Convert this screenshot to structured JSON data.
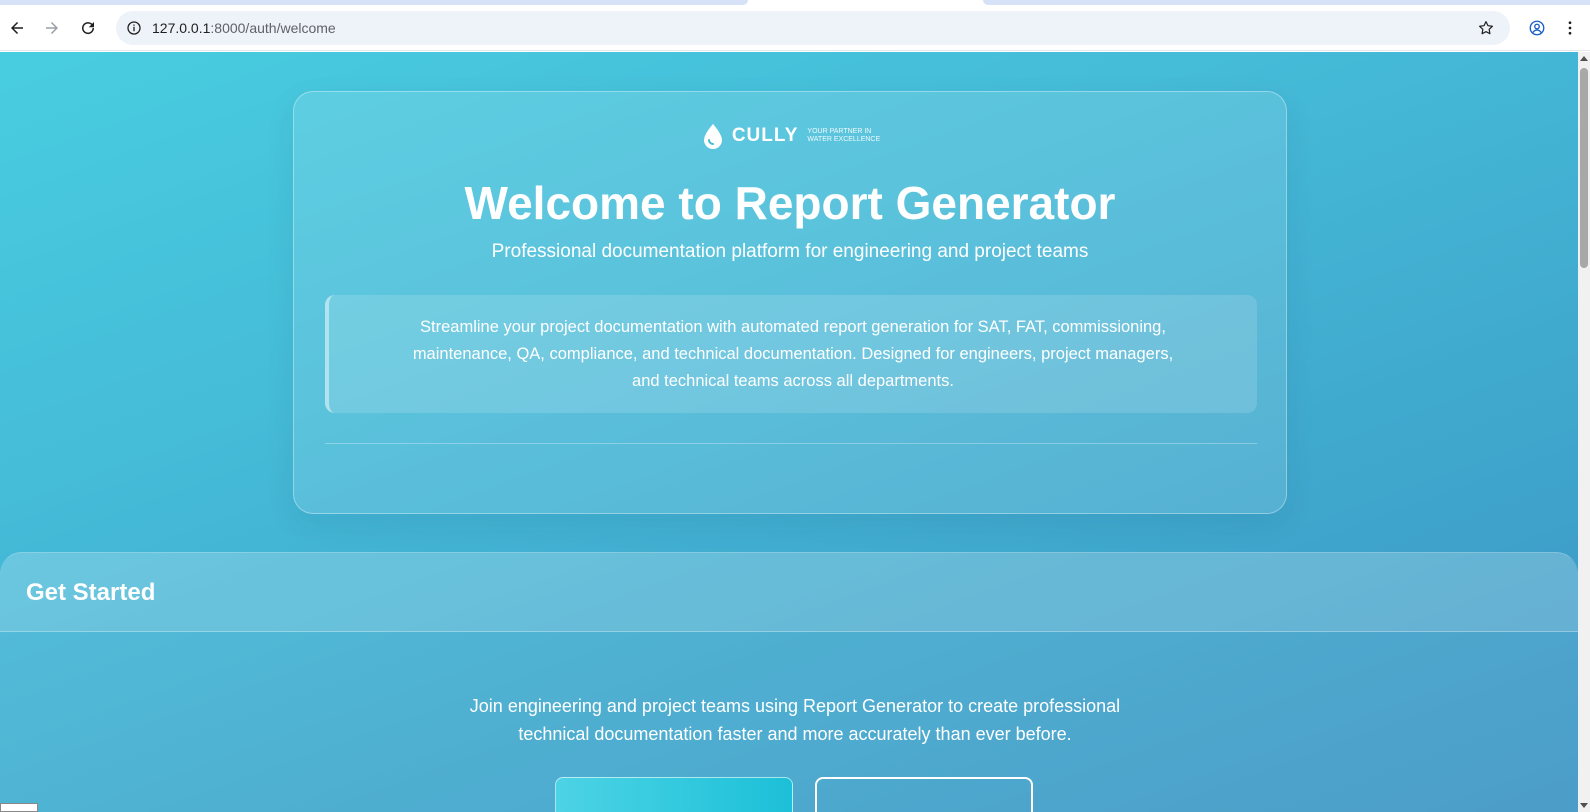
{
  "browser": {
    "url_host": "127.0.0.1",
    "url_path": ":8000/auth/welcome",
    "icons": [
      "back-icon",
      "forward-icon",
      "reload-icon",
      "site-info-icon",
      "bookmark-star-icon",
      "profile-icon",
      "menu-dots-icon"
    ]
  },
  "hero": {
    "logo_brand": "CULLY",
    "logo_tagline_line1": "YOUR PARTNER IN",
    "logo_tagline_line2": "WATER EXCELLENCE",
    "title": "Welcome to Report Generator",
    "subtitle": "Professional documentation platform for engineering and project teams",
    "description": "Streamline your project documentation with automated report generation for SAT, FAT, commissioning, maintenance, QA, compliance, and technical documentation. Designed for engineers, project managers, and technical teams across all departments."
  },
  "get_started": {
    "title": "Get Started",
    "text": "Join engineering and project teams using Report Generator to create professional technical documentation faster and more accurately than ever before."
  },
  "colors": {
    "background_start": "#48cde0",
    "background_end": "#3d95c4",
    "primary_button": "#1cc0d8",
    "text": "#ffffff"
  }
}
